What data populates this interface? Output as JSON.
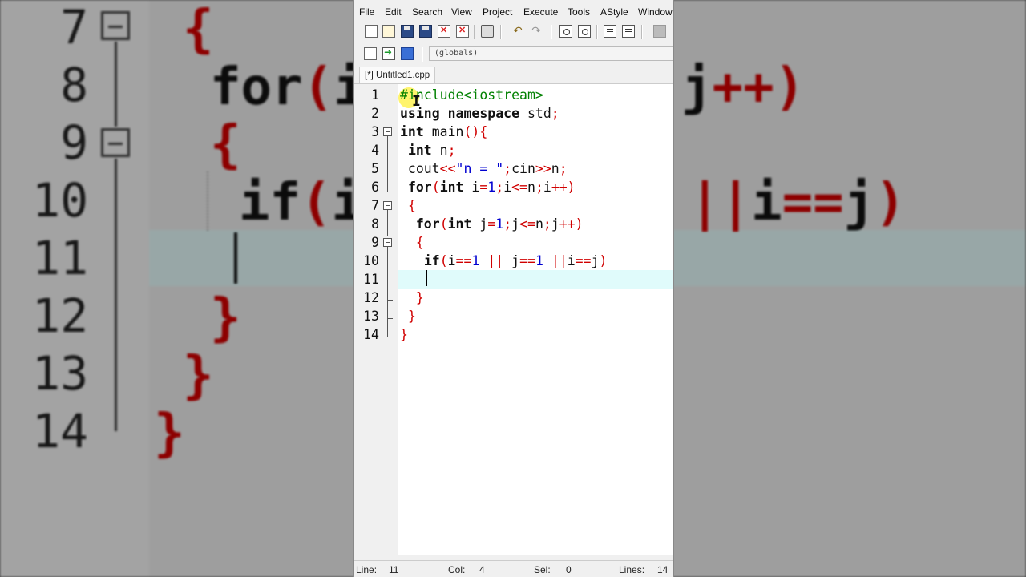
{
  "menu": [
    "File",
    "Edit",
    "Search",
    "View",
    "Project",
    "Execute",
    "Tools",
    "AStyle",
    "Window"
  ],
  "toolbar2": {
    "scope": "(globals)"
  },
  "tab": {
    "label": "[*] Untitled1.cpp"
  },
  "editor": {
    "lines": [
      {
        "n": "1"
      },
      {
        "n": "2"
      },
      {
        "n": "3"
      },
      {
        "n": "4"
      },
      {
        "n": "5"
      },
      {
        "n": "6"
      },
      {
        "n": "7"
      },
      {
        "n": "8"
      },
      {
        "n": "9"
      },
      {
        "n": "10"
      },
      {
        "n": "11"
      },
      {
        "n": "12"
      },
      {
        "n": "13"
      },
      {
        "n": "14"
      }
    ],
    "current_line": 11
  },
  "status": {
    "line_label": "Line:",
    "line_value": "11",
    "col_label": "Col:",
    "col_value": "4",
    "sel_label": "Sel:",
    "sel_value": "0",
    "lines_label": "Lines:",
    "lines_value": "14"
  },
  "background": {
    "line_numbers": [
      "7",
      "8",
      "9",
      "10",
      "11",
      "12",
      "13",
      "14"
    ]
  },
  "colors": {
    "keyword": "#111111",
    "symbol": "#d00000",
    "string": "#0000d0",
    "preprocessor": "#008000",
    "current_line": "#e0fbfb"
  }
}
